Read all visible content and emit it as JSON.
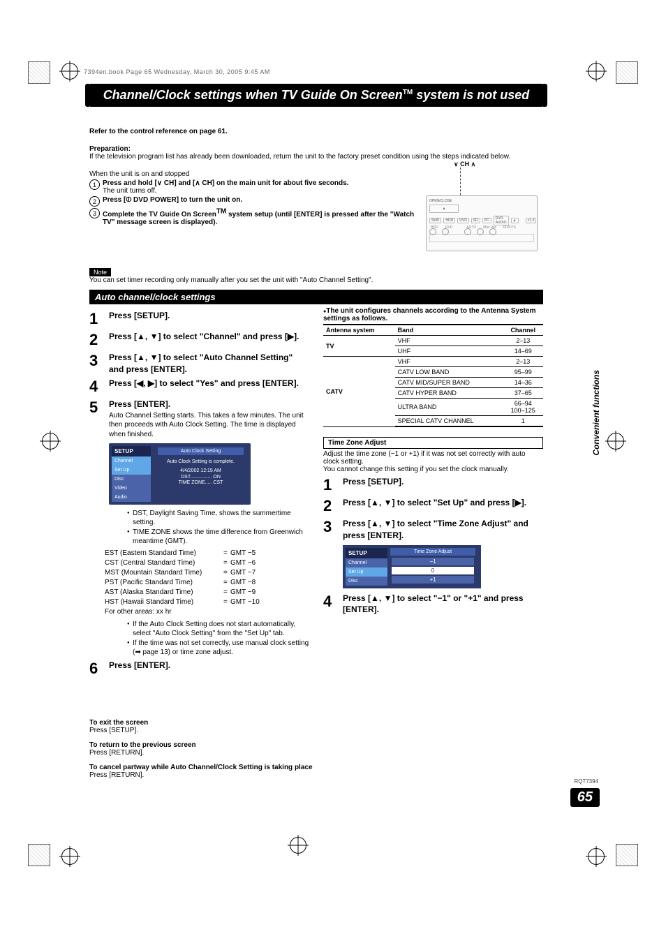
{
  "print_header": "7394en.book  Page 65  Wednesday, March 30, 2005  9:45 AM",
  "title": "Channel/Clock settings when TV Guide On Screen",
  "title_tm": "TM",
  "title_tail": " system is not used",
  "ref_line": "Refer to the control reference on page 61.",
  "prep_h": "Preparation:",
  "prep_body": "If the television program list has already been downloaded, return the unit to the factory preset condition using the steps indicated below.",
  "when_line": "When the unit is on and stopped",
  "pre_steps": {
    "1": "Press and hold [∨ CH] and [∧ CH] on the main unit for about five seconds.",
    "1_sub": "The unit turns off.",
    "2_pre": "Press [",
    "2_post": " DVD POWER] to turn the unit on.",
    "3a": "Complete the TV Guide On Screen",
    "3b": " system setup (until [ENTER] is pressed after the \"Watch TV\" message screen is displayed)."
  },
  "note_tag": "Note",
  "note_body": "You can set timer recording only manually after you set the unit with \"Auto Channel Setting\".",
  "section_h": "Auto channel/clock settings",
  "left_steps": {
    "1": "Press [SETUP].",
    "2": "Press [▲, ▼] to select \"Channel\" and press [▶].",
    "3": "Press [▲, ▼] to select \"Auto Channel Setting\" and press [ENTER].",
    "4": "Press [◀, ▶] to select \"Yes\" and press [ENTER].",
    "5": "Press [ENTER].",
    "5_sub": "Auto Channel Setting starts. This takes a few minutes. The unit then proceeds with Auto Clock Setting. The time is displayed when finished.",
    "6": "Press [ENTER]."
  },
  "mini_ui": {
    "menu_h": "SETUP",
    "items": [
      "Channel",
      "Set Up",
      "Disc",
      "Video",
      "Audio"
    ],
    "panel_title": "Auto Clock Setting",
    "panel_msg": "Auto Clock Setting is complete.",
    "line1": "4/4/2002 12:15 AM",
    "line2": "DST................ ON",
    "line3": "TIME ZONE..... CST"
  },
  "bullets_a": [
    "DST, Daylight Saving Time, shows the summertime setting.",
    "TIME ZONE shows the time difference from Greenwich meantime (GMT)."
  ],
  "tz_rows": [
    {
      "a": "EST (Eastern Standard Time)",
      "b": "=",
      "c": "GMT −5"
    },
    {
      "a": "CST (Central Standard Time)",
      "b": "=",
      "c": "GMT −6"
    },
    {
      "a": "MST (Mountain Standard Time)",
      "b": "=",
      "c": "GMT −7"
    },
    {
      "a": "PST (Pacific Standard Time)",
      "b": "=",
      "c": "GMT −8"
    },
    {
      "a": "AST (Alaska Standard Time)",
      "b": "=",
      "c": "GMT −9"
    },
    {
      "a": "HST (Hawaii Standard Time)",
      "b": "=",
      "c": "GMT −10"
    },
    {
      "a": "For other areas: xx hr",
      "b": "",
      "c": ""
    }
  ],
  "bullets_b": [
    "If the Auto Clock Setting does not start automatically, select \"Auto Clock Setting\" from the \"Set Up\" tab.",
    "If the time was not set correctly, use manual clock setting (➡ page 13) or time zone adjust."
  ],
  "right_intro1": "The unit configures channels according to the Antenna System settings as follows.",
  "band_h": {
    "a": "Antenna system",
    "b": "Band",
    "c": "Channel"
  },
  "band_rows": [
    {
      "a": "TV",
      "b": "VHF",
      "c": "2–13"
    },
    {
      "a": "",
      "b": "UHF",
      "c": "14–69"
    },
    {
      "a": "CATV",
      "b": "VHF",
      "c": "2–13"
    },
    {
      "a": "",
      "b": "CATV LOW BAND",
      "c": "95–99"
    },
    {
      "a": "",
      "b": "CATV MID/SUPER BAND",
      "c": "14–36"
    },
    {
      "a": "",
      "b": "CATV HYPER BAND",
      "c": "37–65"
    },
    {
      "a": "",
      "b": "ULTRA BAND",
      "c": "66–94\n100–125"
    },
    {
      "a": "",
      "b": "SPECIAL CATV CHANNEL",
      "c": "1"
    }
  ],
  "tza_h": "Time Zone Adjust",
  "tza_p1": "Adjust the time zone (−1 or +1) if it was not set correctly with auto clock setting.",
  "tza_p2": "You cannot change this setting if you set the clock manually.",
  "right_steps": {
    "1": "Press [SETUP].",
    "2": "Press [▲, ▼] to select \"Set Up\" and press [▶].",
    "3": "Press [▲, ▼] to select \"Time Zone Adjust\" and press [ENTER].",
    "4": "Press [▲, ▼] to select \"−1\" or \"+1\" and press [ENTER]."
  },
  "tza_ui": {
    "menu_h": "SETUP",
    "items": [
      "Channel",
      "Set Up",
      "Disc"
    ],
    "title": "Time Zone Adjust",
    "rows": [
      "−1",
      "0",
      "+1"
    ]
  },
  "unit": {
    "ch_label": "∨ CH ∧",
    "open": "OPEN/CLOSE",
    "row1": [
      "SKIP",
      "HDD",
      "DVD",
      "SD",
      "PC",
      "DVD-AUDIO",
      "▲",
      "",
      "×1.3"
    ],
    "row2_l": "HDD",
    "row2_r": "DVD",
    "auto": "AUTO",
    "maxvar": "Max Var",
    "dolby": "DD/DTS"
  },
  "side_tab": "Convenient functions",
  "footer": {
    "exit_h": "To exit the screen",
    "exit_b": "Press [SETUP].",
    "ret_h": "To return to the previous screen",
    "ret_b": "Press [RETURN].",
    "cancel_h": "To cancel partway while Auto Channel/Clock Setting is taking place",
    "cancel_b": "Press [RETURN]."
  },
  "doc_code": "RQT7394",
  "page_num": "65"
}
